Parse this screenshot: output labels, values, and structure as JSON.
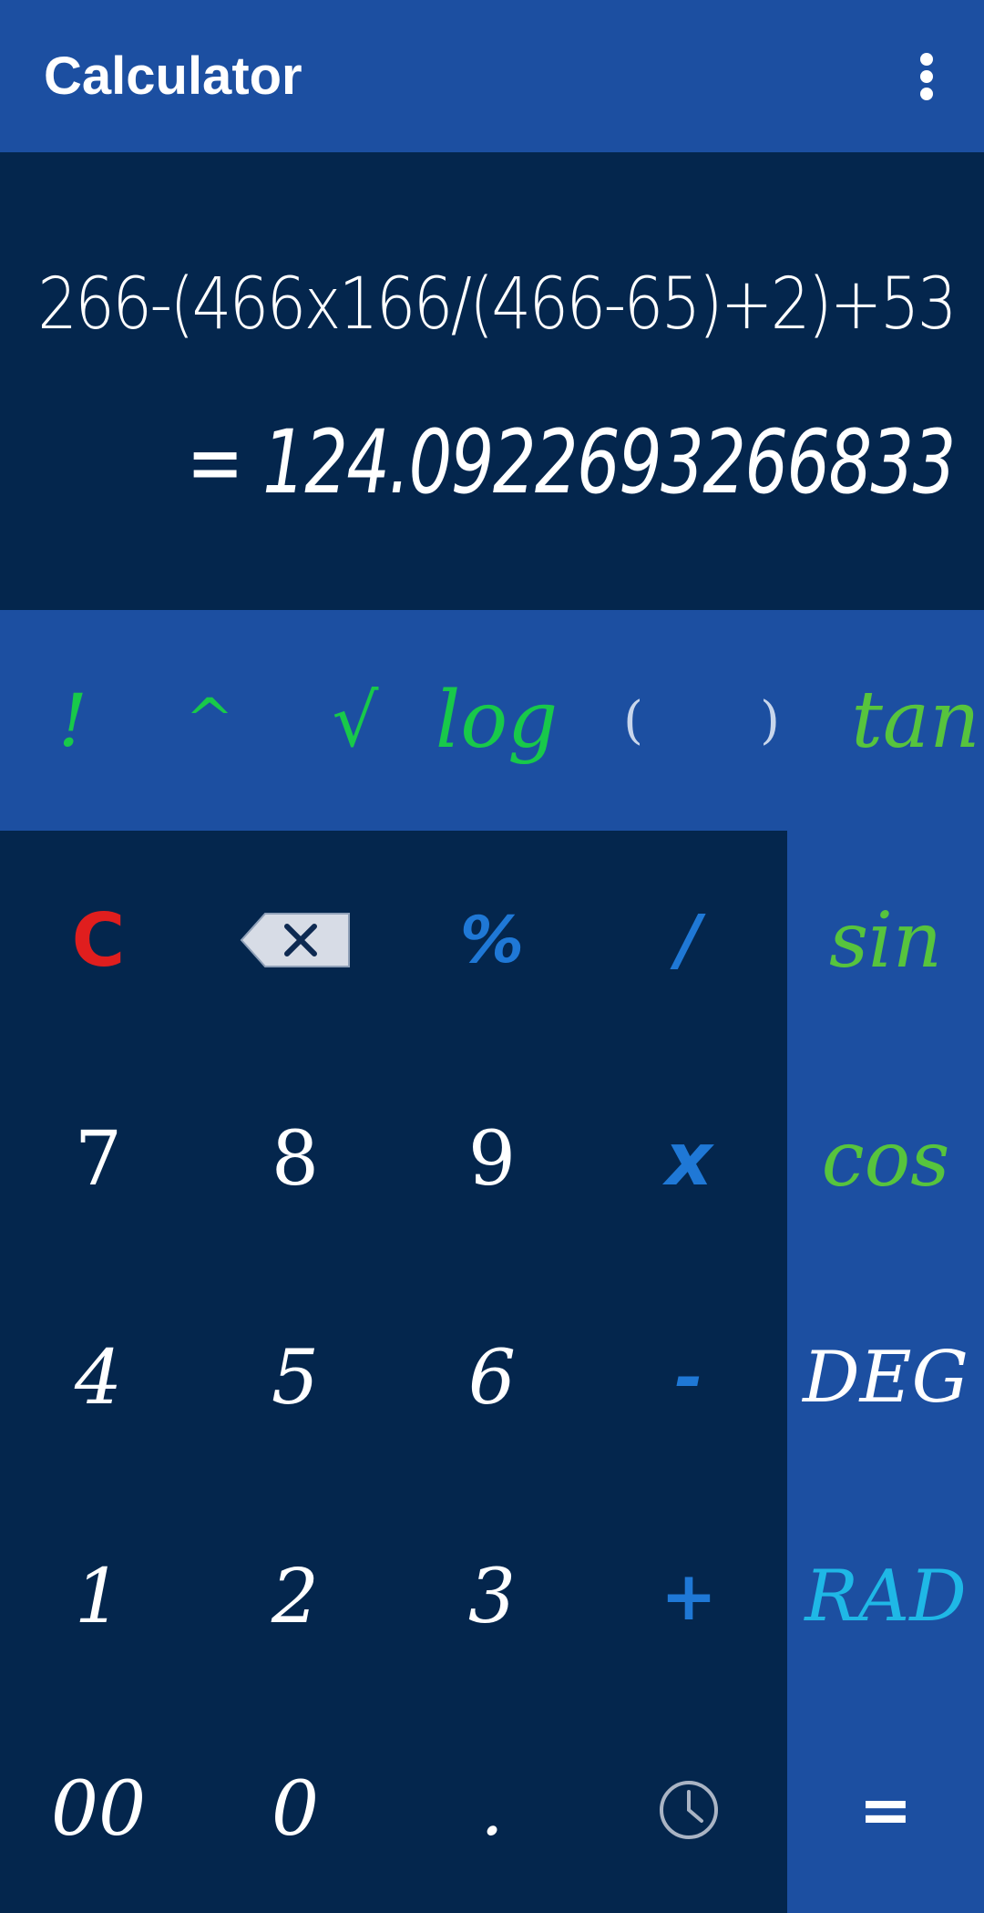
{
  "appbar": {
    "title": "Calculator",
    "menu_icon": "more-vert-icon"
  },
  "display": {
    "expression": "266-(466x166/(466-65)+2)+53",
    "result": "= 124.0922693266833"
  },
  "scientific_row": [
    "!",
    "^",
    "√",
    "log",
    "(",
    ")",
    "tan"
  ],
  "keypad": {
    "clear": "C",
    "backspace_icon": "backspace-icon",
    "percent": "%",
    "divide": "/",
    "seven": "7",
    "eight": "8",
    "nine": "9",
    "multiply": "x",
    "four": "4",
    "five": "5",
    "six": "6",
    "minus": "-",
    "one": "1",
    "two": "2",
    "three": "3",
    "plus": "+",
    "double_zero": "00",
    "zero": "0",
    "dot": ".",
    "history_icon": "history-clock-icon"
  },
  "side_column": {
    "sin": "sin",
    "cos": "cos",
    "deg": "DEG",
    "rad": "RAD",
    "equals": "="
  },
  "colors": {
    "appbar": "#1c4fa1",
    "display_bg": "#04264d",
    "sci_green": "#18c94a",
    "operator_blue": "#1f78d6",
    "clear_red": "#e01e1e",
    "rad_cyan": "#1fb8e6"
  }
}
